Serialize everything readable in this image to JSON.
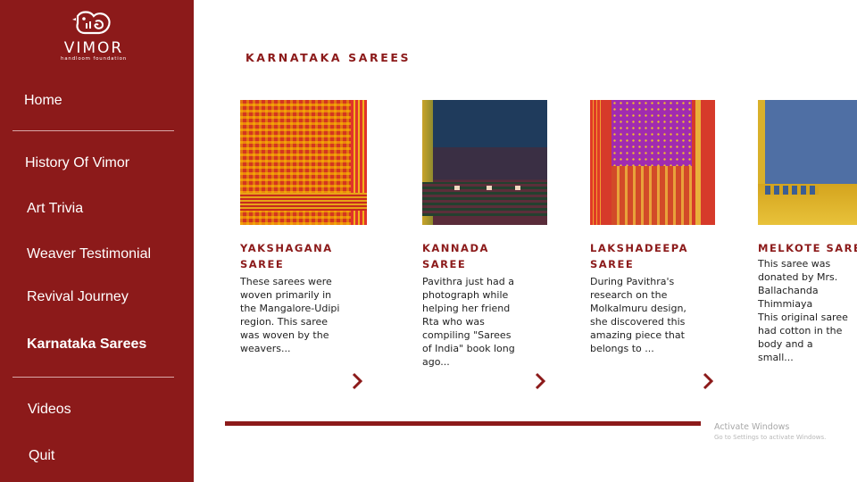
{
  "brand": {
    "name": "VIMOR",
    "tagline": "handloom foundation"
  },
  "nav": {
    "items": [
      {
        "label": "Home"
      },
      {
        "label": "History Of Vimor"
      },
      {
        "label": "Art Trivia"
      },
      {
        "label": "Weaver Testimonial"
      },
      {
        "label": "Revival Journey"
      },
      {
        "label": "Karnataka Sarees",
        "active": true
      },
      {
        "label": "Videos"
      },
      {
        "label": "Quit"
      }
    ]
  },
  "main": {
    "section_title": "KARNATAKA SAREES",
    "carousel_progress": 0.72,
    "cards": [
      {
        "title_line1": "YAKSHAGANA",
        "title_line2": "SAREE",
        "description": "These sarees were woven primarily in the Mangalore-Udipi region. This saree was woven by the weavers...",
        "image": "red-yellow-check-saree"
      },
      {
        "title_line1": "KANNADA",
        "title_line2": "SAREE",
        "description": "Pavithra just had a photograph while helping her friend Rta who was compiling \"Sarees of India\" book long ago...",
        "image": "navy-maroon-saree"
      },
      {
        "title_line1": "LAKSHADEEPA",
        "title_line2": "SAREE",
        "description": "During Pavithra's research on the Molkalmuru design, she discovered this amazing piece that belongs to ...",
        "image": "purple-red-gold-saree"
      },
      {
        "title_line1": "MELKOTE SAREE",
        "title_line2": "",
        "description": "This saree was donated by Mrs. Ballachanda Thimmiaya\nThis original saree had cotton in the body and a small...",
        "image": "blue-gold-border-saree"
      }
    ]
  },
  "watermark": {
    "line1": "Activate Windows",
    "line2": "Go to Settings to activate Windows."
  },
  "colors": {
    "sidebar": "#8c1a1a",
    "accent": "#8c1a1a"
  }
}
